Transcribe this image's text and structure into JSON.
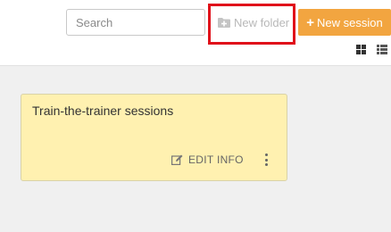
{
  "toolbar": {
    "search_placeholder": "Search",
    "new_folder_label": "New folder",
    "new_session_label": "New session",
    "new_session_color": "#f2a540",
    "highlight_color": "#e0101a"
  },
  "view_toggle": {
    "grid_icon": "grid-view-icon",
    "list_icon": "list-view-icon"
  },
  "cards": [
    {
      "title": "Train-the-trainer sessions",
      "edit_label": "EDIT INFO",
      "background": "#fff1b0"
    }
  ]
}
